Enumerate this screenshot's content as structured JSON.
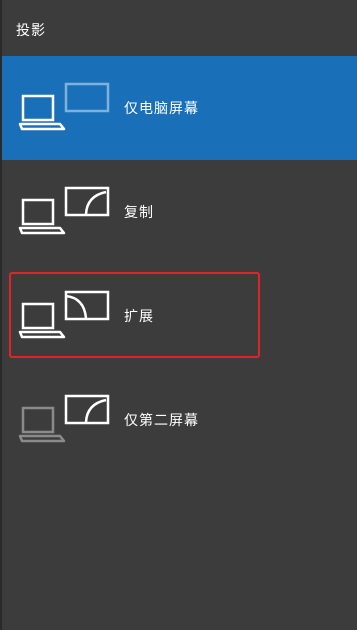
{
  "panel": {
    "title": "投影"
  },
  "options": [
    {
      "label": "仅电脑屏幕",
      "icon": "pc-screen-only-icon",
      "selected": true
    },
    {
      "label": "复制",
      "icon": "duplicate-icon",
      "selected": false
    },
    {
      "label": "扩展",
      "icon": "extend-icon",
      "selected": false
    },
    {
      "label": "仅第二屏幕",
      "icon": "second-screen-only-icon",
      "selected": false
    }
  ],
  "colors": {
    "panel_bg": "#3c3c3c",
    "selected_bg": "#1a6fb9",
    "highlight": "#e0252a",
    "icon_dim": "#8a8a8a",
    "icon_faded_on_blue": "#7fb1da"
  }
}
